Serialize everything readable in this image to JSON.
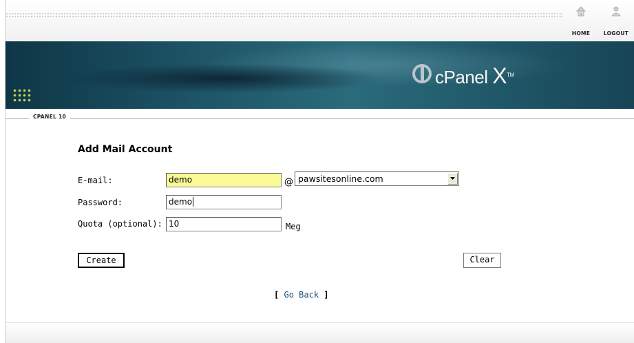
{
  "nav": {
    "home_label": "HOME",
    "logout_label": "LOGOUT"
  },
  "banner": {
    "logo_text": "cPanel",
    "logo_suffix": "X",
    "logo_tm": "TM"
  },
  "breadcrumb": "CPANEL 10",
  "form": {
    "title": "Add Mail Account",
    "email_label": "E-mail:",
    "email_value": "demo",
    "at_symbol": "@",
    "domain_selected": "pawsitesonline.com",
    "password_label": "Password:",
    "password_value": "demo",
    "quota_label": "Quota (optional):",
    "quota_value": "10",
    "quota_unit": "Meg",
    "create_label": "Create",
    "clear_label": "Clear"
  },
  "go_back": {
    "open": "[",
    "label": "Go Back",
    "close": "]"
  },
  "colors": {
    "banner": "#1d5466",
    "focused_input": "#fafa96",
    "link": "#1a4e7a"
  }
}
